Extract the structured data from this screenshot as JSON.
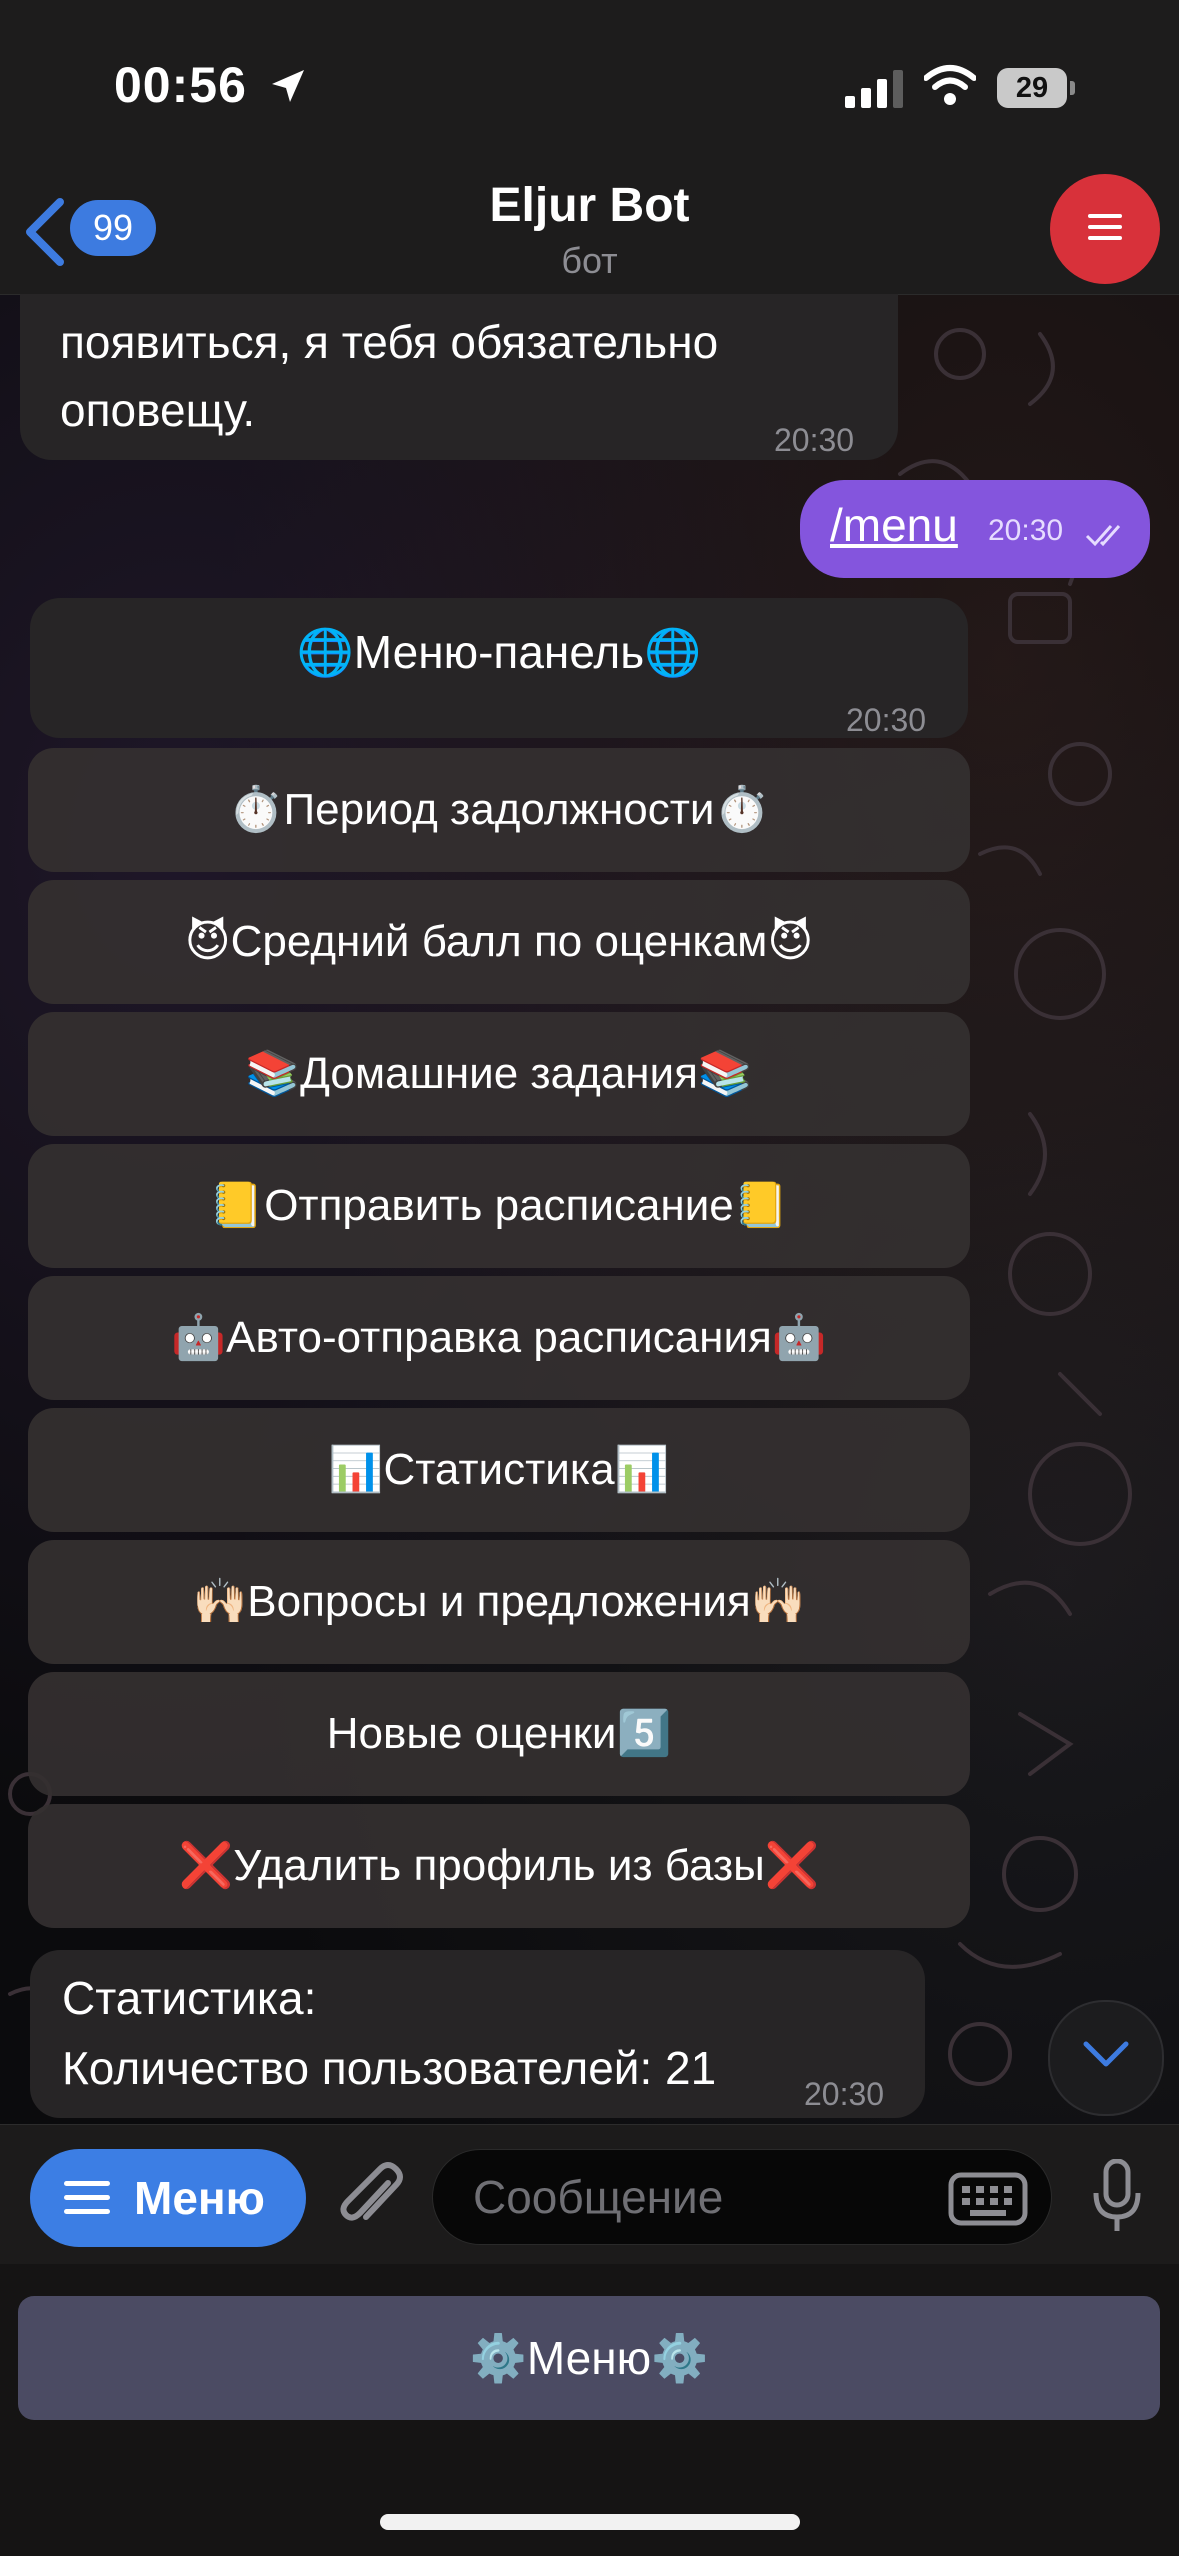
{
  "status_bar": {
    "time": "00:56",
    "battery": "29"
  },
  "header": {
    "back_count": "99",
    "title": "Eljur Bot",
    "subtitle": "бот"
  },
  "messages": {
    "previous": {
      "lines": [
        "появиться, я тебя обязательно",
        "оповещу."
      ],
      "time": "20:30"
    },
    "outgoing": {
      "text": "/menu",
      "time": "20:30"
    },
    "menu_panel": {
      "text": "🌐Меню-панель🌐",
      "time": "20:30"
    },
    "stats": {
      "lines": [
        "Статистика:",
        "Количество пользователей: 21"
      ],
      "time": "20:30"
    }
  },
  "inline_buttons": [
    "⏱️Период задолжности⏱️",
    "😈Средний балл по оценкам😈",
    "📚Домашние задания📚",
    "📒Отправить расписание📒",
    "🤖Авто-отправка расписания🤖",
    "📊Статистика📊",
    "🙌🏻Вопросы и предложения🙌🏻",
    "Новые оценки5️⃣",
    "❌Удалить профиль из базы❌"
  ],
  "input": {
    "menu_label": "Меню",
    "placeholder": "Сообщение"
  },
  "reply_keyboard": {
    "button": "⚙️Меню⚙️"
  },
  "colors": {
    "accent": "#3c7ee4",
    "outgoing_bubble": "#8455dd",
    "menu_fab": "#d8313a"
  },
  "icons": [
    "location-arrow-icon",
    "signal-icon",
    "wifi-icon",
    "battery-icon",
    "back-chevron-icon",
    "hamburger-icon",
    "read-check-icon",
    "scroll-down-chevron-icon",
    "attach-icon",
    "keyboard-icon",
    "microphone-icon"
  ]
}
